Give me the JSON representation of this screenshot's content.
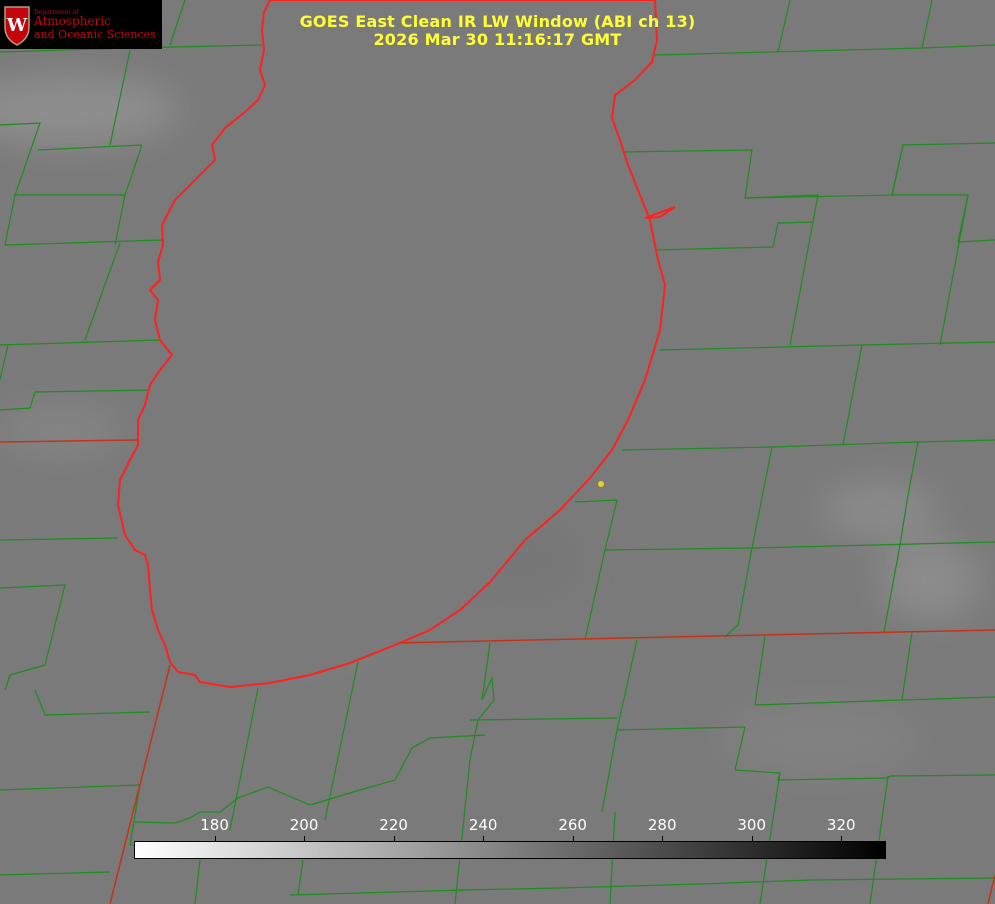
{
  "title": "GOES East Clean IR LW Window (ABI ch 13)",
  "timestamp": "2026 Mar 30 11:16:17 GMT",
  "logo": {
    "dept_label": "Department of",
    "line1": "Atmospheric",
    "line2": "and Oceanic Sciences",
    "crest_letter": "W",
    "brand_color": "#c5050c"
  },
  "colorbar": {
    "ticks": [
      "180",
      "200",
      "220",
      "240",
      "260",
      "280",
      "300",
      "320"
    ],
    "range": [
      162,
      330
    ],
    "gradient": [
      "#ffffff",
      "#000000"
    ]
  },
  "colors": {
    "title": "#ffff33",
    "county_lines": "#1e8c1e",
    "state_lines": "#c83214",
    "lake_outline": "#ff2020",
    "marker": "#e8d020"
  },
  "icons": [
    "wisconsin-crest-icon",
    "location-dot-icon"
  ]
}
